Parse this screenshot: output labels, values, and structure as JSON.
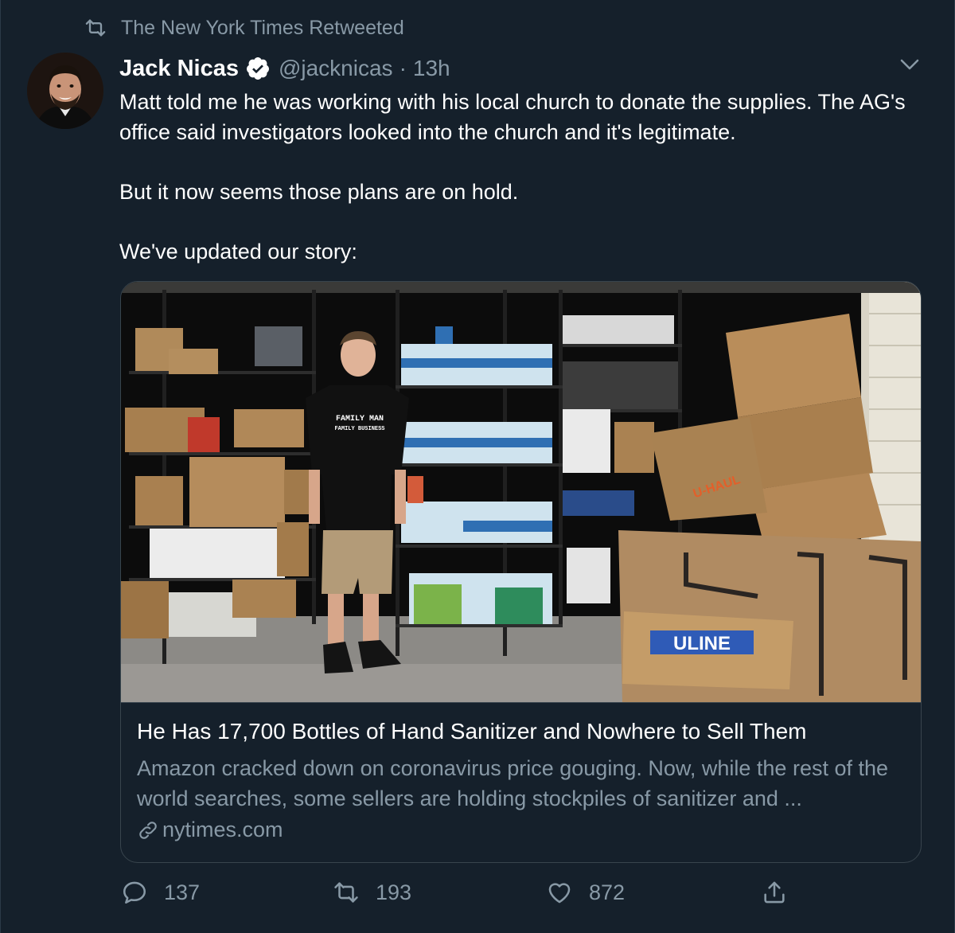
{
  "social_context": {
    "text": "The New York Times Retweeted"
  },
  "author": {
    "name": "Jack Nicas",
    "handle": "@jacknicas",
    "separator": "·",
    "time": "13h",
    "verified": true
  },
  "tweet": {
    "paragraphs": [
      "Matt told me he was working with his local church to donate the supplies. The AG's office said investigators looked into the church and it's legitimate.",
      "But it now seems those plans are on hold.",
      "We've updated our story:"
    ]
  },
  "card": {
    "title": "He Has 17,700 Bottles of Hand Sanitizer and Nowhere to Sell Them",
    "description": "Amazon cracked down on coronavirus price gouging. Now, while the rest of the world searches, some sellers are holding stockpiles of sanitizer and ...",
    "domain": "nytimes.com",
    "image": {
      "shirt_text_line1": "FAMILY MAN",
      "shirt_text_line2": "FAMILY BUSINESS",
      "box_label": "ULINE",
      "uhaul_label": "U-HAUL"
    }
  },
  "actions": {
    "replies": "137",
    "retweets": "193",
    "likes": "872"
  },
  "colors": {
    "background": "#15202b",
    "secondary_text": "#8899a6",
    "border": "#38444d",
    "verified": "#ffffff"
  }
}
